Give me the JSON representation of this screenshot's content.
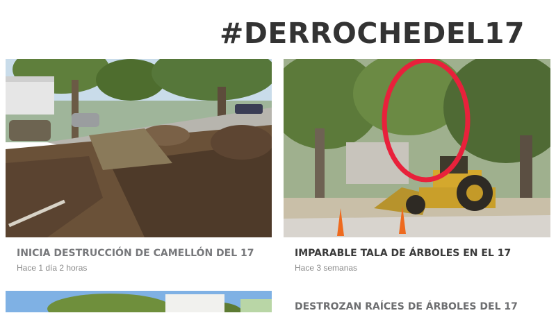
{
  "header": {
    "hashtag": "#DERROCHEDEL17"
  },
  "articles": [
    {
      "title": "INICIA DESTRUCCIÓN DE CAMELLÓN DEL 17",
      "time": "Hace 1 día 2 horas",
      "title_color": "#77787b"
    },
    {
      "title": "IMPARABLE TALA DE ÁRBOLES EN EL 17",
      "time": "Hace 3 semanas",
      "title_color": "#3a3a3a"
    },
    {
      "title": "DESTROZAN RAÍCES  DE ÁRBOLES DEL 17",
      "time": "",
      "title_color": "#6d6e70"
    }
  ]
}
